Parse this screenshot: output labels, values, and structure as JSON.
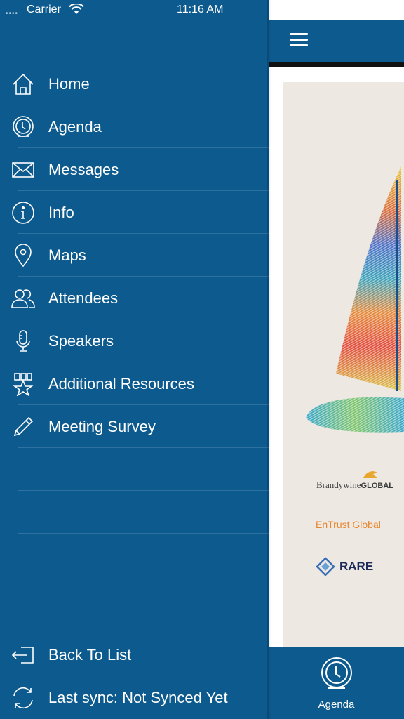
{
  "status": {
    "carrier": "Carrier",
    "time": "11:16 AM"
  },
  "menu": {
    "items": [
      {
        "label": "Home",
        "icon": "home-icon"
      },
      {
        "label": "Agenda",
        "icon": "clock-icon"
      },
      {
        "label": "Messages",
        "icon": "envelope-icon"
      },
      {
        "label": "Info",
        "icon": "info-icon"
      },
      {
        "label": "Maps",
        "icon": "map-pin-icon"
      },
      {
        "label": "Attendees",
        "icon": "people-icon"
      },
      {
        "label": "Speakers",
        "icon": "microphone-icon"
      },
      {
        "label": "Additional Resources",
        "icon": "badge-star-icon"
      },
      {
        "label": "Meeting Survey",
        "icon": "pencil-icon"
      }
    ]
  },
  "footer": {
    "back_label": "Back To List",
    "sync_label": "Last sync:  Not Synced Yet"
  },
  "poster": {
    "logo1_script": "Brandywine",
    "logo1_bold": "GLOBAL",
    "logo2": "EnTrust Global",
    "logo3": "RARE"
  },
  "tabbar": {
    "label": "Agenda"
  },
  "colors": {
    "primary": "#0c5a8e",
    "poster_bg": "#ede8e2"
  }
}
